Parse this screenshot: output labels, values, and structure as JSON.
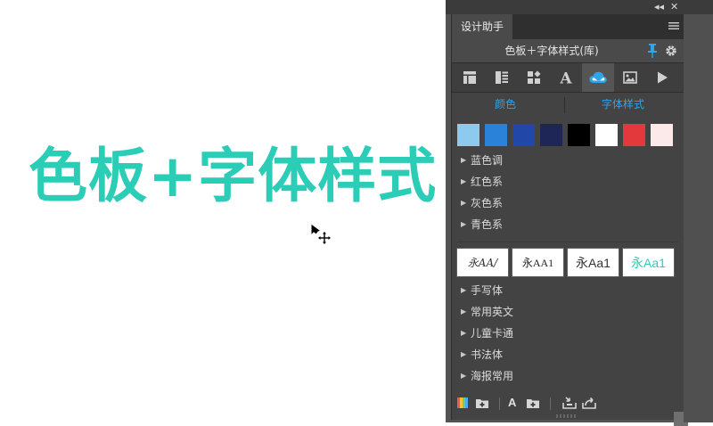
{
  "hero": {
    "text": "色板+字体样式",
    "color": "#2bcdb7"
  },
  "panel": {
    "top_buttons": {
      "collapse": "◂◂",
      "close": "✕"
    },
    "tab_label": "设计助手",
    "subtitle": "色板＋字体样式(库)",
    "icon_tabs": [
      "layout-icon",
      "list-layout-icon",
      "components-icon",
      "text-icon",
      "creative-cloud-icon",
      "image-icon",
      "play-icon"
    ],
    "subtabs": {
      "colors": "颜色",
      "fonts": "字体样式"
    },
    "accent": "#2fa4e7",
    "swatches": [
      "#8ec9ee",
      "#2a83d9",
      "#2148a8",
      "#1e2557",
      "#000000",
      "#ffffff",
      "#e3393c",
      "#fce9e9"
    ],
    "color_groups": [
      "蓝色调",
      "红色系",
      "灰色系",
      "青色系"
    ],
    "font_samples": [
      {
        "text": "永AA/",
        "color": "#333333"
      },
      {
        "text": "永AA1",
        "color": "#222222"
      },
      {
        "text": "永Aa1",
        "color": "#333333"
      },
      {
        "text": "永Aa1",
        "color": "#2bcdb7"
      }
    ],
    "font_groups": [
      "手写体",
      "常用英文",
      "儿童卡通",
      "书法体",
      "海报常用"
    ],
    "bottom_text_icon": "A"
  }
}
